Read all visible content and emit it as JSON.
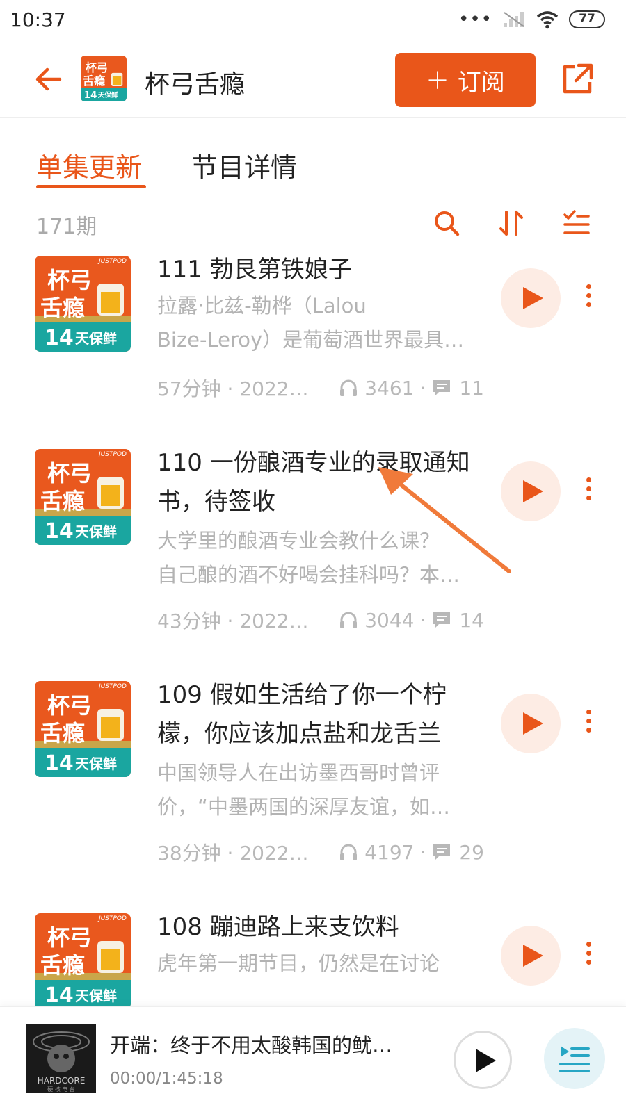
{
  "status_bar": {
    "time": "10:37",
    "signal_dots": "•••",
    "battery": "77"
  },
  "header": {
    "title": "杯弓舌瘾",
    "subscribe_label": "订阅",
    "subscribe_plus": "+"
  },
  "cover_art": {
    "line1": "杯弓",
    "line2": "舌瘾",
    "badge_num": "14",
    "badge_text": "天保鲜",
    "brand": "JUSTPOD"
  },
  "tabs": [
    {
      "label": "单集更新",
      "active": true
    },
    {
      "label": "节目详情",
      "active": false
    }
  ],
  "toolbar": {
    "episode_count": "171期"
  },
  "episodes": [
    {
      "title": "111 勃艮第铁娘子",
      "desc_lines": [
        "拉露·比兹-勒桦（Lalou",
        "Bize-Leroy）是葡萄酒世界最具…"
      ],
      "duration_date": "57分钟 · 2022/0…",
      "plays": "3461",
      "comments": "11"
    },
    {
      "title": "110 一份酿酒专业的录取通知书，待签收",
      "desc_lines": [
        "大学里的酿酒专业会教什么课？",
        "自己酿的酒不好喝会挂科吗？本…"
      ],
      "duration_date": "43分钟 · 2022/0…",
      "plays": "3044",
      "comments": "14"
    },
    {
      "title": "109 假如生活给了你一个柠檬，你应该加点盐和龙舌兰",
      "desc_lines": [
        "中国领导人在出访墨西哥时曾评",
        "价，“中墨两国的深厚友谊，如…"
      ],
      "duration_date": "38分钟 · 2022/0…",
      "plays": "4197",
      "comments": "29"
    },
    {
      "title": "108 蹦迪路上来支饮料",
      "desc_lines": [
        "虎年第一期节目，仍然是在讨论"
      ],
      "duration_date": "",
      "plays": "",
      "comments": ""
    }
  ],
  "player": {
    "title": "开端：终于不用太酸韩国的鱿…",
    "time": "00:00/1:45:18",
    "cover_text": "HARDCORE",
    "cover_sub": "硬 核 电 台"
  },
  "colors": {
    "accent": "#e9561a",
    "text": "#222222",
    "muted": "#b3b3b3",
    "play_bg": "#fdece4"
  }
}
